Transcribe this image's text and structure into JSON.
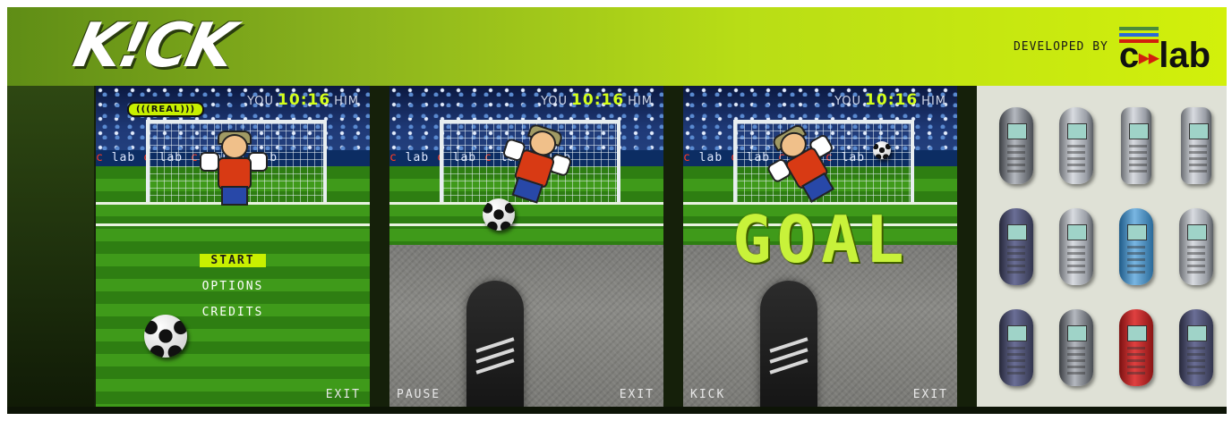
{
  "logo": {
    "text": "K!CK",
    "badge": "(((REAL)))"
  },
  "developer": {
    "label": "DEVELOPED BY",
    "brand": "c lab",
    "stripe_colors": [
      "#4a8a3a",
      "#2b6ad8",
      "#d2200d"
    ]
  },
  "screens": [
    {
      "id": "menu",
      "hud": {
        "you": "YOU",
        "score": "10:16",
        "him": "HIM"
      },
      "banner": "c lab c lab c lab c lab",
      "menu_items": [
        {
          "label": "START",
          "active": true
        },
        {
          "label": "OPTIONS",
          "active": false
        },
        {
          "label": "CREDITS",
          "active": false
        }
      ],
      "left_soft_key": "",
      "right_soft_key": "EXIT"
    },
    {
      "id": "shot",
      "hud": {
        "you": "YOU",
        "score": "10:16",
        "him": "HIM"
      },
      "banner": "c lab c lab c lab c lab",
      "left_soft_key": "PAUSE",
      "right_soft_key": "EXIT"
    },
    {
      "id": "goal",
      "hud": {
        "you": "YOU",
        "score": "10:16",
        "him": "HIM"
      },
      "banner": "c lab c lab c lab c lab",
      "overlay_text": "GOAL",
      "left_soft_key": "KICK",
      "right_soft_key": "EXIT"
    }
  ],
  "phones": [
    "phone-icon",
    "phone-icon",
    "flip-phone-icon",
    "flip-phone-icon",
    "phone-icon",
    "phone-icon",
    "phone-icon",
    "phone-icon",
    "phone-icon",
    "phone-icon",
    "phone-icon",
    "phone-icon"
  ],
  "colors": {
    "accent": "#c8f000",
    "score": "#d4ff1a",
    "brand_red": "#d2200d"
  }
}
